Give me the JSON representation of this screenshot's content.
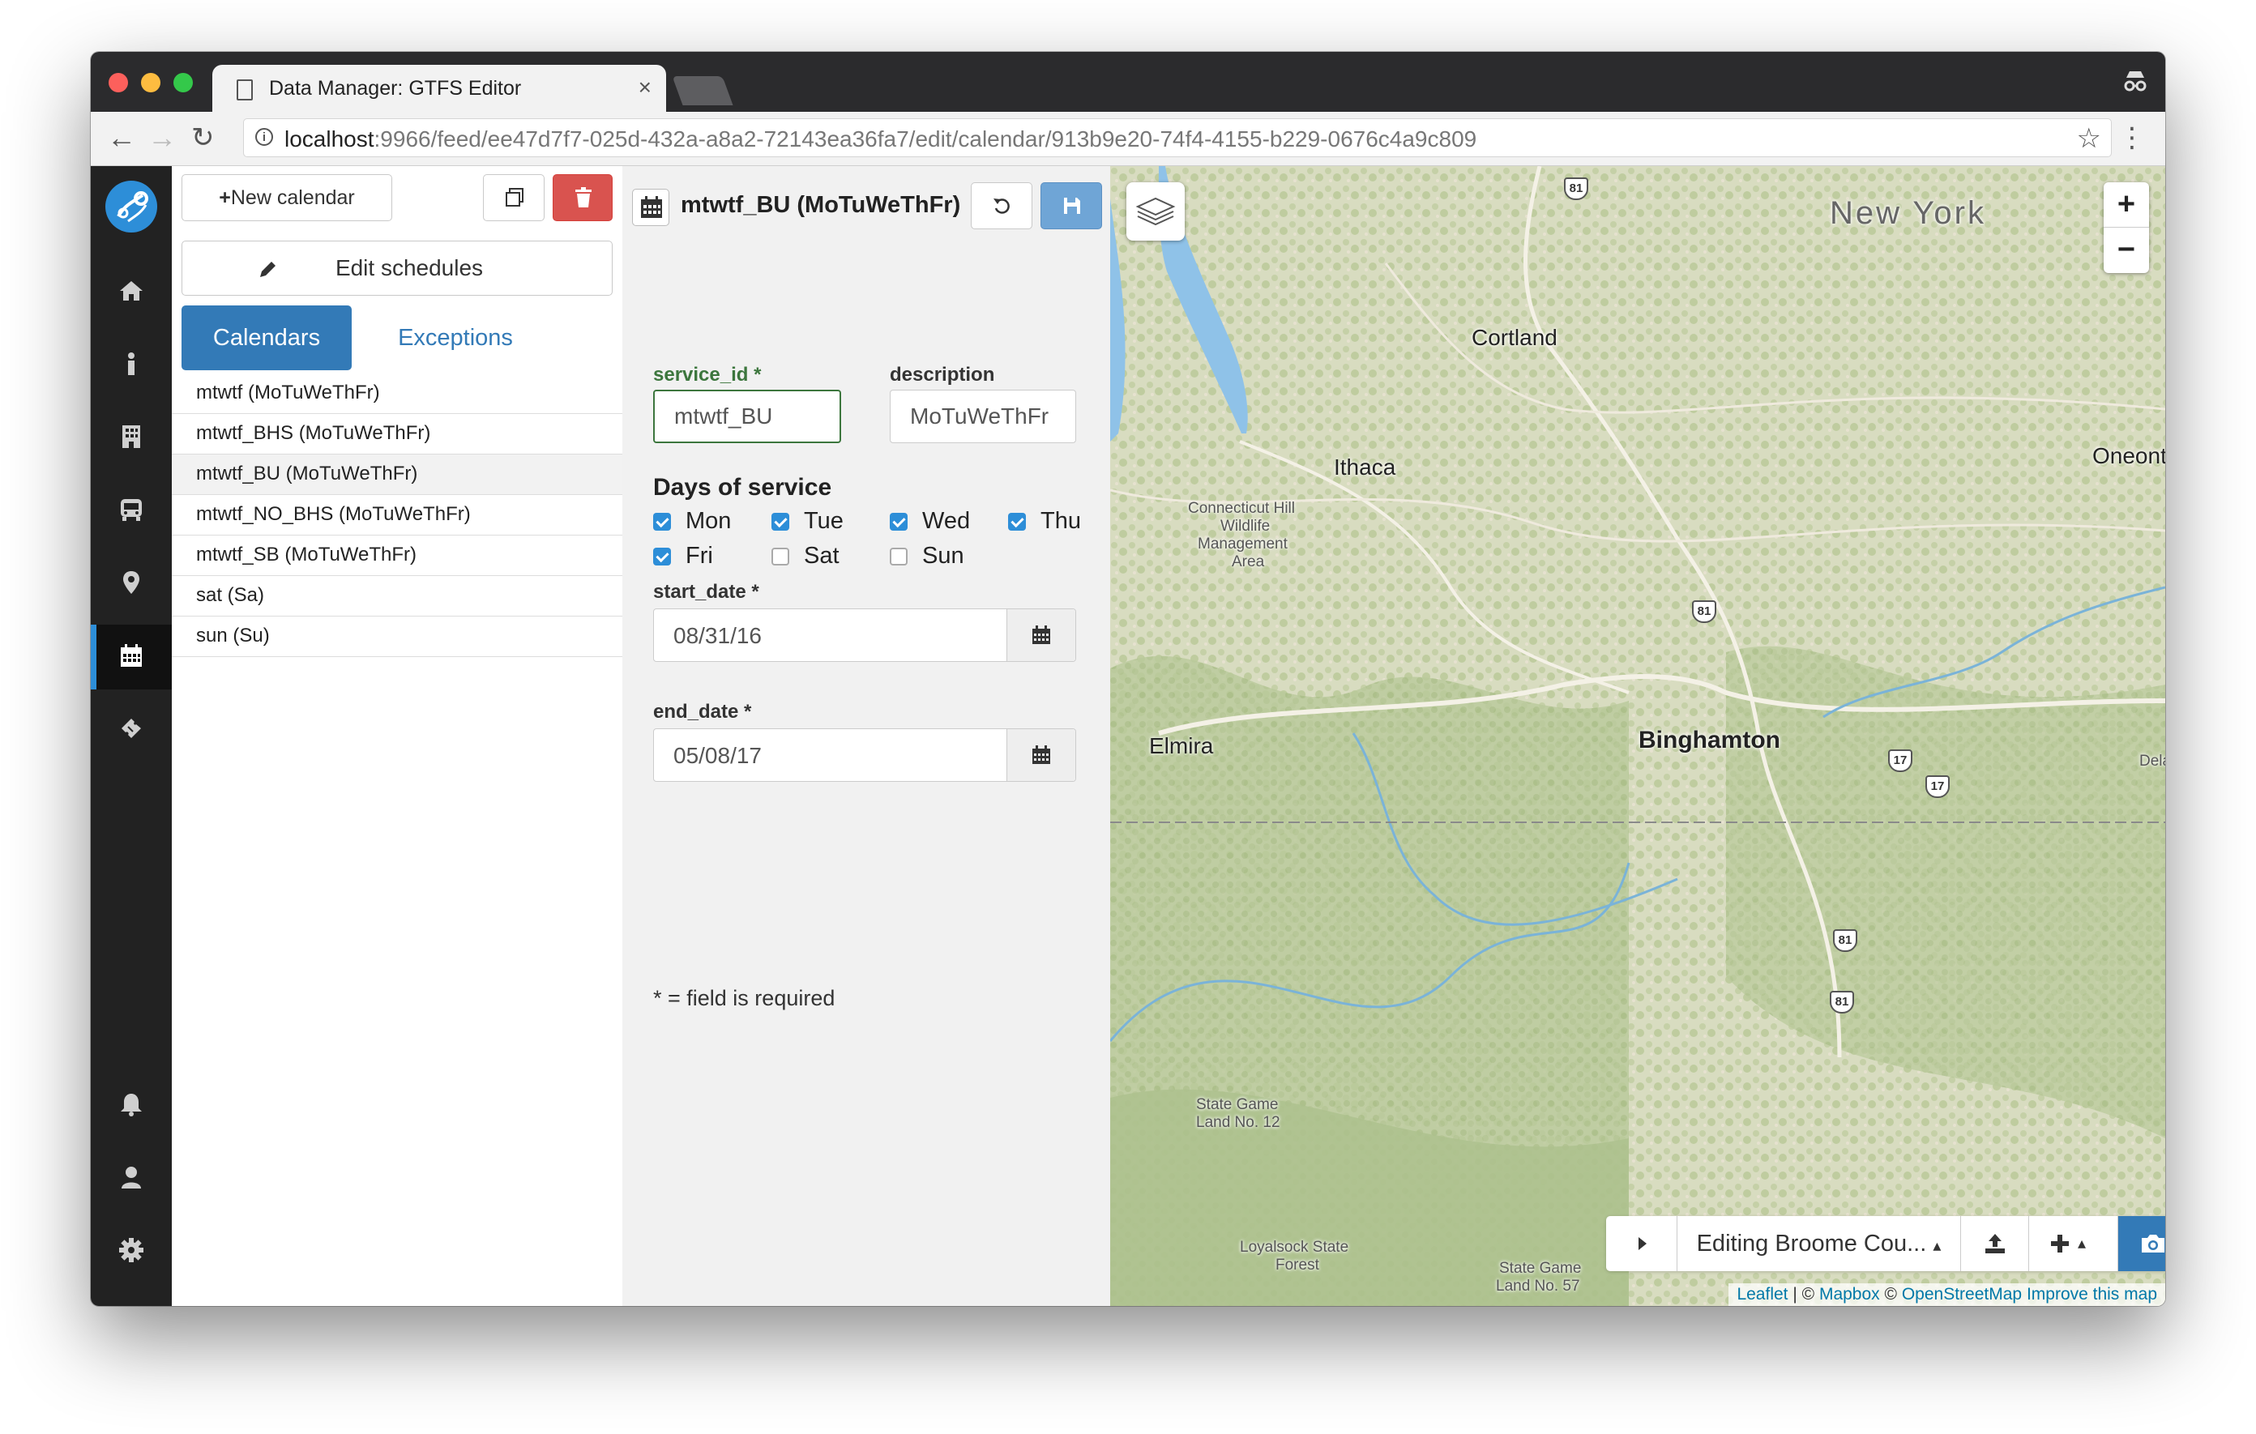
{
  "browser": {
    "tab_title": "Data Manager: GTFS Editor",
    "tab_close": "×",
    "url_host": "localhost",
    "url_rest": ":9966/feed/ee47d7f7-025d-432a-a8a2-72143ea36fa7/edit/calendar/913b9e20-74f4-4155-b229-0676c4a9c809"
  },
  "calendar_panel": {
    "new_button": "New calendar",
    "edit_schedules": "Edit schedules",
    "tabs": {
      "calendars": "Calendars",
      "exceptions": "Exceptions"
    },
    "items": [
      "mtwtf (MoTuWeThFr)",
      "mtwtf_BHS (MoTuWeThFr)",
      "mtwtf_BU (MoTuWeThFr)",
      "mtwtf_NO_BHS (MoTuWeThFr)",
      "mtwtf_SB (MoTuWeThFr)",
      "sat (Sa)",
      "sun (Su)"
    ],
    "selected_index": 2
  },
  "form": {
    "title": "mtwtf_BU (MoTuWeThFr)",
    "service_id_label": "service_id *",
    "service_id_value": "mtwtf_BU",
    "description_label": "description",
    "description_value": "MoTuWeThFr",
    "days_title": "Days of service",
    "days": [
      {
        "label": "Mon",
        "checked": true
      },
      {
        "label": "Tue",
        "checked": true
      },
      {
        "label": "Wed",
        "checked": true
      },
      {
        "label": "Thu",
        "checked": true
      },
      {
        "label": "Fri",
        "checked": true
      },
      {
        "label": "Sat",
        "checked": false
      },
      {
        "label": "Sun",
        "checked": false
      }
    ],
    "start_date_label": "start_date *",
    "start_date_value": "08/31/16",
    "end_date_label": "end_date *",
    "end_date_value": "05/08/17",
    "required_note": "* = field is required"
  },
  "map": {
    "places": {
      "new_york": "New York",
      "cortland": "Cortland",
      "ithaca": "Ithaca",
      "oneonta": "Oneonta",
      "binghamton": "Binghamton",
      "elmira": "Elmira",
      "delaware": "Dela",
      "connecticut_hill_1": "Connecticut Hill",
      "connecticut_hill_2": "Wildlife",
      "connecticut_hill_3": "Management",
      "connecticut_hill_4": "Area",
      "sgl12_1": "State Game",
      "sgl12_2": "Land No. 12",
      "loyalsock_1": "Loyalsock State",
      "loyalsock_2": "Forest",
      "sgl57_1": "State Game",
      "sgl57_2": "Land No. 57"
    },
    "highways": [
      "81",
      "81",
      "17",
      "17",
      "81",
      "81"
    ],
    "zoom_in": "+",
    "zoom_out": "−",
    "toolbar": {
      "editing_label": "Editing Broome Cou...",
      "caret": "▴"
    },
    "attribution": {
      "leaflet": "Leaflet",
      "separator": " | © ",
      "mapbox": "Mapbox",
      "osm_prefix": " © ",
      "osm": "OpenStreetMap",
      "improve": "Improve this map"
    }
  }
}
